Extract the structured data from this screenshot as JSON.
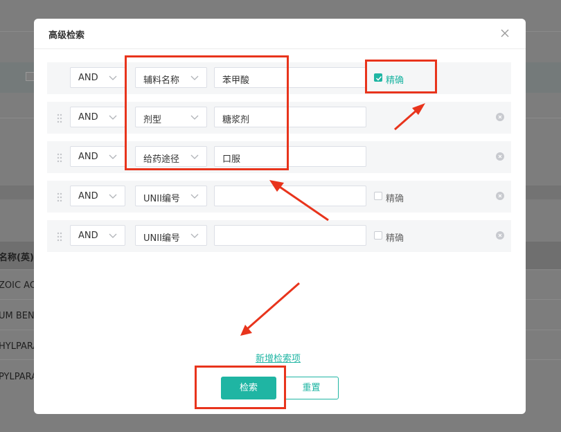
{
  "background": {
    "column_header": "名称(英)",
    "rows": [
      "ZOIC ACI",
      "UM BEN",
      "HYLPARA",
      "PYLPARA"
    ]
  },
  "dialog": {
    "title": "高级检索",
    "rows": [
      {
        "logic": "AND",
        "field": "辅料名称",
        "value": "苯甲酸",
        "exact_label": "精确",
        "exact_checked": true,
        "removable": false
      },
      {
        "logic": "AND",
        "field": "剂型",
        "value": "糖浆剂",
        "exact_label": "",
        "exact_checked": false,
        "removable": true
      },
      {
        "logic": "AND",
        "field": "给药途径",
        "value": "口服",
        "exact_label": "",
        "exact_checked": false,
        "removable": true
      },
      {
        "logic": "AND",
        "field": "UNII编号",
        "value": "",
        "exact_label": "精确",
        "exact_checked": false,
        "removable": true
      },
      {
        "logic": "AND",
        "field": "UNII编号",
        "value": "",
        "exact_label": "精确",
        "exact_checked": false,
        "removable": true
      }
    ],
    "add_link": "新增检索项",
    "search_button": "检索",
    "reset_button": "重置"
  },
  "colors": {
    "accent": "#1fb5a3",
    "annotation": "#e8341c"
  }
}
